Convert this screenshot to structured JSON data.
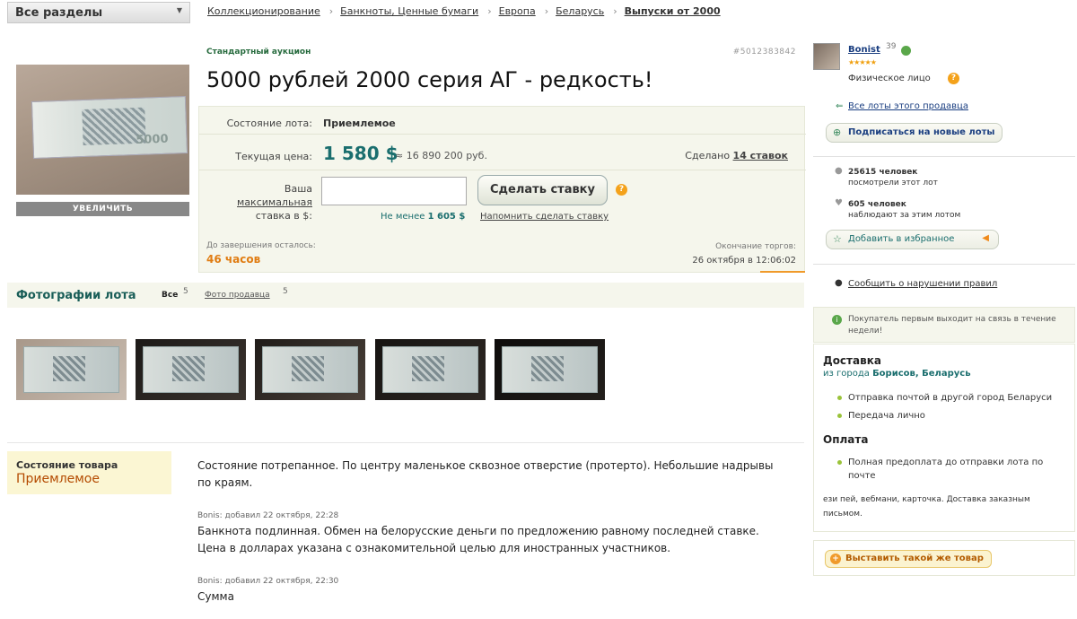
{
  "topbar": {
    "sections_label": "Все разделы",
    "breadcrumbs": [
      "Коллекционирование",
      "Банкноты, Ценные бумаги",
      "Европа",
      "Беларусь",
      "Выпуски от 2000"
    ]
  },
  "gallery": {
    "enlarge_label": "УВЕЛИЧИТЬ"
  },
  "lot": {
    "auction_type": "Стандартный аукцион",
    "lot_id": "#5012383842",
    "title": "5000 рублей 2000 серия АГ - редкость!",
    "condition_label": "Состояние лота:",
    "condition_value": "Приемлемое",
    "price_label": "Текущая цена:",
    "price_value": "1 580 $",
    "price_rub": "≈ 16 890 200 руб.",
    "bids_made_prefix": "Сделано",
    "bids_made_link": "14 ставок",
    "max_bid_label_1": "Ваша",
    "max_bid_label_link": "максимальная",
    "max_bid_label_2": "ставка в $:",
    "bid_input_value": "",
    "bid_button": "Сделать ставку",
    "min_bid_prefix": "Не менее",
    "min_bid_value": "1 605 $",
    "remind_link": "Напомнить сделать ставку",
    "remaining_label": "До завершения осталось:",
    "remaining_value": "46 часов",
    "end_label": "Окончание торгов:",
    "end_value": "26 октября в 12:06:02"
  },
  "photos": {
    "title": "Фотографии лота",
    "tab_all": "Все",
    "tab_all_count": "5",
    "tab_seller": "Фото продавца",
    "tab_seller_count": "5",
    "thumbs": [
      "t1",
      "t2",
      "t3",
      "t4",
      "t5"
    ]
  },
  "description": {
    "condition_label": "Состояние товара",
    "condition_value": "Приемлемое",
    "text_main": "Состояние потрепанное. По центру маленькое сквозное отверстие (протерто). Небольшие надрывы по краям.",
    "addendum1_meta": "Bonis: добавил 22 октября, 22:28",
    "addendum1_text": "Банкнота подлинная. Обмен на белорусские деньги по предложению равному последней ставке. Цена в долларах указана с ознакомительной целью для иностранных участников.",
    "addendum2_meta": "Bonis: добавил 22 октября, 22:30",
    "addendum2_text": "Сумма"
  },
  "seller": {
    "name": "Bonist",
    "rating": "39",
    "stars": "★★★★★",
    "type": "Физическое лицо",
    "all_lots_link": "Все лоты этого продавца",
    "subscribe_button": "Подписаться на новые лоты",
    "views_count": "25615 человек",
    "views_text": "посмотрели этот лот",
    "watch_count": "605 человек",
    "watch_text": "наблюдают за этим лотом",
    "favorite_button": "Добавить в избранное",
    "report_link": "Сообщить о нарушении правил",
    "notice_text": "Покупатель первым выходит на связь в течение недели!"
  },
  "shipping": {
    "delivery_title": "Доставка",
    "from_prefix": "из города",
    "from_city": "Борисов, Беларусь",
    "delivery_items": [
      "Отправка почтой в другой город Беларуси",
      "Передача лично"
    ],
    "payment_title": "Оплата",
    "payment_items": [
      "Полная предоплата до отправки лота по почте"
    ],
    "payment_note": "ези пей, вебмани, карточка. Доставка заказным письмом."
  },
  "sell_similar": {
    "button": "Выставить такой же товар"
  },
  "colors": {
    "accent_teal": "#1a6e6e",
    "accent_orange": "#e07c12",
    "panel_bg": "#f5f6ec"
  }
}
